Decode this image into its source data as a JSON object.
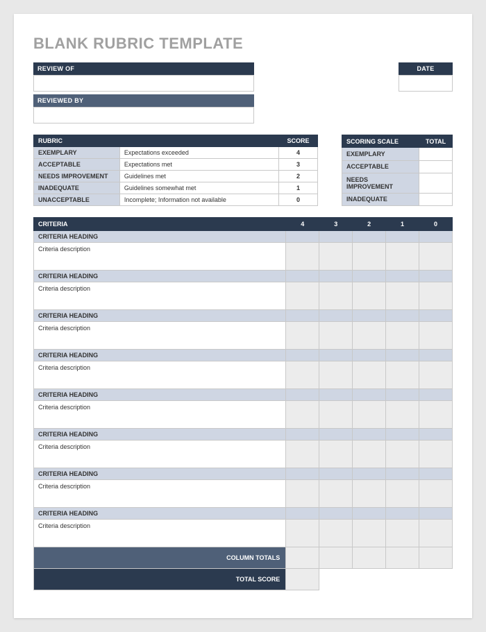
{
  "title": "BLANK RUBRIC TEMPLATE",
  "header": {
    "review_of_label": "REVIEW OF",
    "reviewed_by_label": "REVIEWED BY",
    "date_label": "DATE"
  },
  "rubric": {
    "header_rubric": "RUBRIC",
    "header_score": "SCORE",
    "rows": [
      {
        "label": "EXEMPLARY",
        "desc": "Expectations exceeded",
        "score": "4"
      },
      {
        "label": "ACCEPTABLE",
        "desc": "Expectations met",
        "score": "3"
      },
      {
        "label": "NEEDS IMPROVEMENT",
        "desc": "Guidelines met",
        "score": "2"
      },
      {
        "label": "INADEQUATE",
        "desc": "Guidelines somewhat met",
        "score": "1"
      },
      {
        "label": "UNACCEPTABLE",
        "desc": "Incomplete; Information not available",
        "score": "0"
      }
    ]
  },
  "scoring_scale": {
    "header_scale": "SCORING SCALE",
    "header_total": "TOTAL",
    "rows": [
      {
        "label": "EXEMPLARY"
      },
      {
        "label": "ACCEPTABLE"
      },
      {
        "label": "NEEDS IMPROVEMENT"
      },
      {
        "label": "INADEQUATE"
      }
    ]
  },
  "criteria": {
    "header_criteria": "CRITERIA",
    "score_headers": [
      "4",
      "3",
      "2",
      "1",
      "0"
    ],
    "rows": [
      {
        "heading": "CRITERIA HEADING",
        "desc": "Criteria description"
      },
      {
        "heading": "CRITERIA HEADING",
        "desc": "Criteria description"
      },
      {
        "heading": "CRITERIA HEADING",
        "desc": "Criteria description"
      },
      {
        "heading": "CRITERIA HEADING",
        "desc": "Criteria description"
      },
      {
        "heading": "CRITERIA HEADING",
        "desc": "Criteria description"
      },
      {
        "heading": "CRITERIA HEADING",
        "desc": "Criteria description"
      },
      {
        "heading": "CRITERIA HEADING",
        "desc": "Criteria description"
      },
      {
        "heading": "CRITERIA HEADING",
        "desc": "Criteria description"
      }
    ],
    "column_totals_label": "COLUMN TOTALS",
    "total_score_label": "TOTAL SCORE"
  }
}
